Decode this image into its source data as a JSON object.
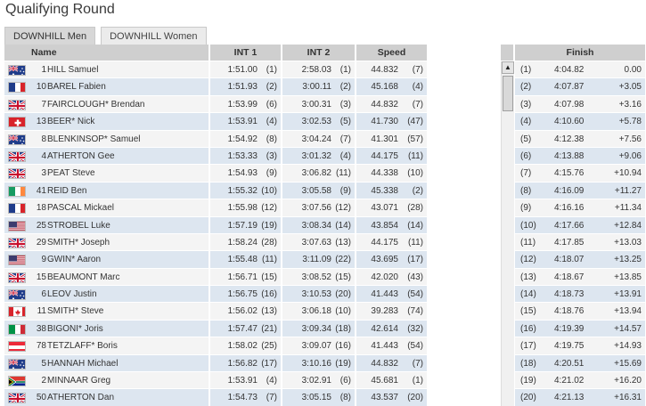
{
  "title": "Qualifying Round",
  "tabs": [
    {
      "label": "DOWNHILL Men",
      "active": true
    },
    {
      "label": "DOWNHILL Women",
      "active": false
    }
  ],
  "columns": {
    "name": "Name",
    "int1": "INT 1",
    "int2": "INT 2",
    "speed": "Speed",
    "finish": "Finish"
  },
  "rows": [
    {
      "flag": "AUS",
      "bib": "1",
      "name": "HILL Samuel",
      "int1": "1:51.00",
      "int1_rank": "(1)",
      "int2": "2:58.03",
      "int2_rank": "(1)",
      "speed": "44.832",
      "speed_rank": "(7)",
      "rank": "(1)",
      "finish": "4:04.82",
      "gap": "0.00"
    },
    {
      "flag": "FRA",
      "bib": "10",
      "name": "BAREL Fabien",
      "int1": "1:51.93",
      "int1_rank": "(2)",
      "int2": "3:00.11",
      "int2_rank": "(2)",
      "speed": "45.168",
      "speed_rank": "(4)",
      "rank": "(2)",
      "finish": "4:07.87",
      "gap": "+3.05"
    },
    {
      "flag": "GBR",
      "bib": "7",
      "name": "FAIRCLOUGH* Brendan",
      "int1": "1:53.99",
      "int1_rank": "(6)",
      "int2": "3:00.31",
      "int2_rank": "(3)",
      "speed": "44.832",
      "speed_rank": "(7)",
      "rank": "(3)",
      "finish": "4:07.98",
      "gap": "+3.16"
    },
    {
      "flag": "SUI",
      "bib": "13",
      "name": "BEER* Nick",
      "int1": "1:53.91",
      "int1_rank": "(4)",
      "int2": "3:02.53",
      "int2_rank": "(5)",
      "speed": "41.730",
      "speed_rank": "(47)",
      "rank": "(4)",
      "finish": "4:10.60",
      "gap": "+5.78"
    },
    {
      "flag": "AUS",
      "bib": "8",
      "name": "BLENKINSOP* Samuel",
      "int1": "1:54.92",
      "int1_rank": "(8)",
      "int2": "3:04.24",
      "int2_rank": "(7)",
      "speed": "41.301",
      "speed_rank": "(57)",
      "rank": "(5)",
      "finish": "4:12.38",
      "gap": "+7.56"
    },
    {
      "flag": "GBR",
      "bib": "4",
      "name": "ATHERTON Gee",
      "int1": "1:53.33",
      "int1_rank": "(3)",
      "int2": "3:01.32",
      "int2_rank": "(4)",
      "speed": "44.175",
      "speed_rank": "(11)",
      "rank": "(6)",
      "finish": "4:13.88",
      "gap": "+9.06"
    },
    {
      "flag": "GBR",
      "bib": "3",
      "name": "PEAT Steve",
      "int1": "1:54.93",
      "int1_rank": "(9)",
      "int2": "3:06.82",
      "int2_rank": "(11)",
      "speed": "44.338",
      "speed_rank": "(10)",
      "rank": "(7)",
      "finish": "4:15.76",
      "gap": "+10.94"
    },
    {
      "flag": "IRL",
      "bib": "41",
      "name": "REID Ben",
      "int1": "1:55.32",
      "int1_rank": "(10)",
      "int2": "3:05.58",
      "int2_rank": "(9)",
      "speed": "45.338",
      "speed_rank": "(2)",
      "rank": "(8)",
      "finish": "4:16.09",
      "gap": "+11.27"
    },
    {
      "flag": "FRA",
      "bib": "18",
      "name": "PASCAL Mickael",
      "int1": "1:55.98",
      "int1_rank": "(12)",
      "int2": "3:07.56",
      "int2_rank": "(12)",
      "speed": "43.071",
      "speed_rank": "(28)",
      "rank": "(9)",
      "finish": "4:16.16",
      "gap": "+11.34"
    },
    {
      "flag": "USA",
      "bib": "25",
      "name": "STROBEL Luke",
      "int1": "1:57.19",
      "int1_rank": "(19)",
      "int2": "3:08.34",
      "int2_rank": "(14)",
      "speed": "43.854",
      "speed_rank": "(14)",
      "rank": "(10)",
      "finish": "4:17.66",
      "gap": "+12.84"
    },
    {
      "flag": "GBR",
      "bib": "29",
      "name": "SMITH* Joseph",
      "int1": "1:58.24",
      "int1_rank": "(28)",
      "int2": "3:07.63",
      "int2_rank": "(13)",
      "speed": "44.175",
      "speed_rank": "(11)",
      "rank": "(11)",
      "finish": "4:17.85",
      "gap": "+13.03"
    },
    {
      "flag": "USA",
      "bib": "9",
      "name": "GWIN* Aaron",
      "int1": "1:55.48",
      "int1_rank": "(11)",
      "int2": "3:11.09",
      "int2_rank": "(22)",
      "speed": "43.695",
      "speed_rank": "(17)",
      "rank": "(12)",
      "finish": "4:18.07",
      "gap": "+13.25"
    },
    {
      "flag": "GBR",
      "bib": "15",
      "name": "BEAUMONT Marc",
      "int1": "1:56.71",
      "int1_rank": "(15)",
      "int2": "3:08.52",
      "int2_rank": "(15)",
      "speed": "42.020",
      "speed_rank": "(43)",
      "rank": "(13)",
      "finish": "4:18.67",
      "gap": "+13.85"
    },
    {
      "flag": "AUS",
      "bib": "6",
      "name": "LEOV Justin",
      "int1": "1:56.75",
      "int1_rank": "(16)",
      "int2": "3:10.53",
      "int2_rank": "(20)",
      "speed": "41.443",
      "speed_rank": "(54)",
      "rank": "(14)",
      "finish": "4:18.73",
      "gap": "+13.91"
    },
    {
      "flag": "CAN",
      "bib": "11",
      "name": "SMITH* Steve",
      "int1": "1:56.02",
      "int1_rank": "(13)",
      "int2": "3:06.18",
      "int2_rank": "(10)",
      "speed": "39.283",
      "speed_rank": "(74)",
      "rank": "(15)",
      "finish": "4:18.76",
      "gap": "+13.94"
    },
    {
      "flag": "ITA",
      "bib": "38",
      "name": "BIGONI* Joris",
      "int1": "1:57.47",
      "int1_rank": "(21)",
      "int2": "3:09.34",
      "int2_rank": "(18)",
      "speed": "42.614",
      "speed_rank": "(32)",
      "rank": "(16)",
      "finish": "4:19.39",
      "gap": "+14.57"
    },
    {
      "flag": "AUT",
      "bib": "78",
      "name": "TETZLAFF* Boris",
      "int1": "1:58.02",
      "int1_rank": "(25)",
      "int2": "3:09.07",
      "int2_rank": "(16)",
      "speed": "41.443",
      "speed_rank": "(54)",
      "rank": "(17)",
      "finish": "4:19.75",
      "gap": "+14.93"
    },
    {
      "flag": "AUS",
      "bib": "5",
      "name": "HANNAH Michael",
      "int1": "1:56.82",
      "int1_rank": "(17)",
      "int2": "3:10.16",
      "int2_rank": "(19)",
      "speed": "44.832",
      "speed_rank": "(7)",
      "rank": "(18)",
      "finish": "4:20.51",
      "gap": "+15.69"
    },
    {
      "flag": "RSA",
      "bib": "2",
      "name": "MINNAAR Greg",
      "int1": "1:53.91",
      "int1_rank": "(4)",
      "int2": "3:02.91",
      "int2_rank": "(6)",
      "speed": "45.681",
      "speed_rank": "(1)",
      "rank": "(19)",
      "finish": "4:21.02",
      "gap": "+16.20"
    },
    {
      "flag": "GBR",
      "bib": "50",
      "name": "ATHERTON Dan",
      "int1": "1:54.73",
      "int1_rank": "(7)",
      "int2": "3:05.15",
      "int2_rank": "(8)",
      "speed": "43.537",
      "speed_rank": "(20)",
      "rank": "(20)",
      "finish": "4:21.13",
      "gap": "+16.31"
    }
  ],
  "scrollbar": {
    "up_arrow": "▲"
  }
}
